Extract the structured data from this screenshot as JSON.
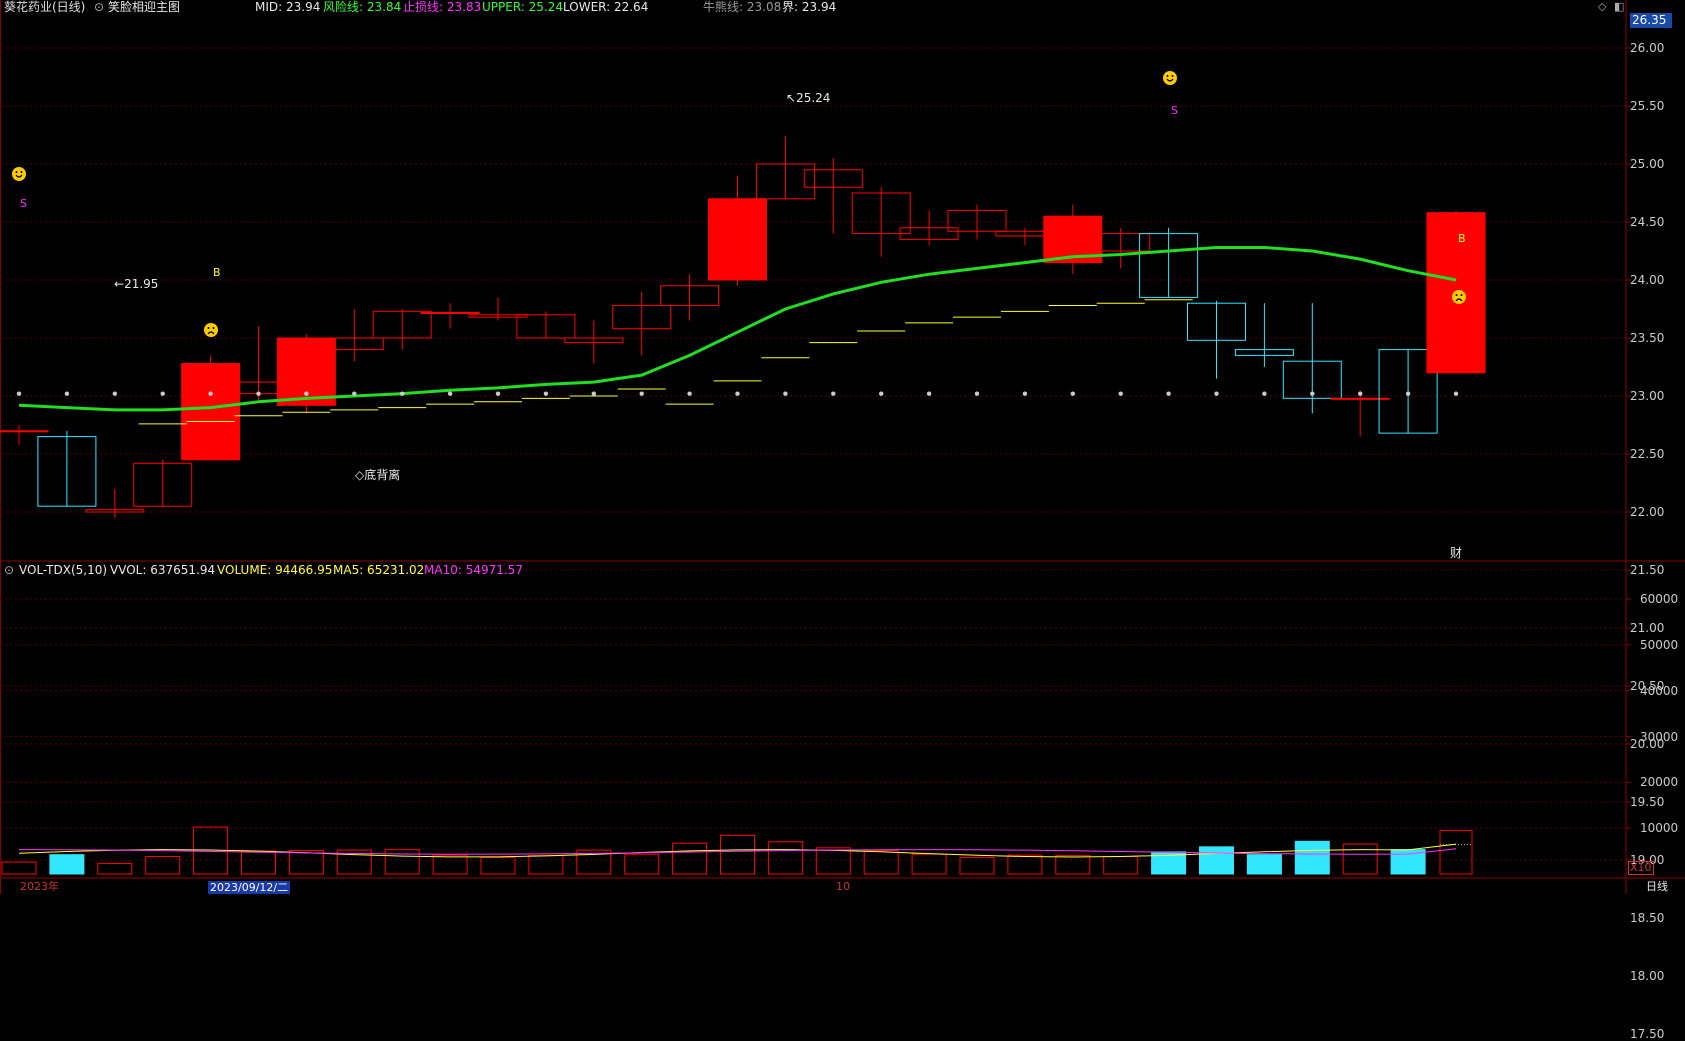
{
  "header": {
    "stock_title": "葵花药业(日线)",
    "formula_name": "笑脸相迎主图",
    "mid_label": "MID: 23.94",
    "risk_label": "风险线: 23.84",
    "stop_label": "止损线: 23.83",
    "upper_label": "UPPER: 25.24",
    "lower_label": "LOWER: 22.64",
    "bull_bear_label": "牛熊线: 23.08",
    "boundary_label": "界: 23.94"
  },
  "volume_header": {
    "indicator": "VOL-TDX(5,10)",
    "vvol": "VVOL: 637651.94",
    "volume": "VOLUME: 94466.95",
    "ma5": "MA5: 65231.02",
    "ma10": "MA10: 54971.57"
  },
  "price_axis": {
    "current_price": "26.35",
    "ticks": [
      "26.00",
      "25.50",
      "25.00",
      "24.50",
      "24.00",
      "23.50",
      "23.00",
      "22.50",
      "22.00",
      "21.50",
      "21.00",
      "20.50",
      "20.00",
      "19.50",
      "19.00",
      "18.50",
      "18.00",
      "17.50"
    ]
  },
  "volume_axis": {
    "ticks": [
      "60000",
      "50000",
      "40000",
      "30000",
      "20000",
      "10000"
    ],
    "multiplier": "X10"
  },
  "annotations": {
    "high_label": "25.24",
    "low_label": "21.95",
    "divergence_label": "底背离",
    "finance_marker": "财",
    "signal_s": "S",
    "signal_b": "B"
  },
  "bottom_bar": {
    "year_label": "2023年",
    "selected_date": "2023/09/12/二",
    "month_label": "10",
    "period_label": "日线"
  },
  "colors": {
    "up": "#ff0000",
    "down": "#33e6ff",
    "mid_line": "#22dd22",
    "risk_line": "#ffff33",
    "ma10": "#ff33ff",
    "grid": "#5a0000",
    "background": "#000000"
  },
  "chart_data": {
    "type": "candlestick",
    "candles": [
      {
        "open": 22.7,
        "close": 22.7,
        "high": 22.75,
        "low": 22.58,
        "volume": 2600
      },
      {
        "open": 22.65,
        "close": 22.05,
        "high": 22.7,
        "low": 22.05,
        "volume": 4200
      },
      {
        "open": 22.0,
        "close": 22.02,
        "high": 22.2,
        "low": 21.95,
        "volume": 2300
      },
      {
        "open": 22.05,
        "close": 22.42,
        "high": 22.45,
        "low": 22.05,
        "volume": 3800
      },
      {
        "open": 22.45,
        "close": 23.28,
        "high": 23.35,
        "low": 22.45,
        "volume": 10200
      },
      {
        "open": 23.02,
        "close": 23.12,
        "high": 23.6,
        "low": 22.95,
        "volume": 5000
      },
      {
        "open": 22.92,
        "close": 23.5,
        "high": 23.53,
        "low": 22.85,
        "volume": 5100
      },
      {
        "open": 23.4,
        "close": 23.5,
        "high": 23.75,
        "low": 23.3,
        "volume": 5200
      },
      {
        "open": 23.5,
        "close": 23.73,
        "high": 23.75,
        "low": 23.4,
        "volume": 5300
      },
      {
        "open": 23.72,
        "close": 23.72,
        "high": 23.8,
        "low": 23.58,
        "volume": 4100
      },
      {
        "open": 23.68,
        "close": 23.7,
        "high": 23.85,
        "low": 23.65,
        "volume": 3600
      },
      {
        "open": 23.5,
        "close": 23.7,
        "high": 23.73,
        "low": 23.5,
        "volume": 4000
      },
      {
        "open": 23.46,
        "close": 23.5,
        "high": 23.65,
        "low": 23.28,
        "volume": 5200
      },
      {
        "open": 23.58,
        "close": 23.78,
        "high": 23.9,
        "low": 23.35,
        "volume": 4300
      },
      {
        "open": 23.78,
        "close": 23.95,
        "high": 24.05,
        "low": 23.65,
        "volume": 6700
      },
      {
        "open": 24.0,
        "close": 24.7,
        "high": 24.9,
        "low": 23.95,
        "volume": 8400
      },
      {
        "open": 24.7,
        "close": 25.0,
        "high": 25.24,
        "low": 24.7,
        "volume": 7000
      },
      {
        "open": 24.8,
        "close": 24.95,
        "high": 25.05,
        "low": 24.4,
        "volume": 5700
      },
      {
        "open": 24.4,
        "close": 24.75,
        "high": 24.8,
        "low": 24.2,
        "volume": 5100
      },
      {
        "open": 24.35,
        "close": 24.45,
        "high": 24.6,
        "low": 24.3,
        "volume": 4300
      },
      {
        "open": 24.42,
        "close": 24.6,
        "high": 24.65,
        "low": 24.35,
        "volume": 3600
      },
      {
        "open": 24.38,
        "close": 24.42,
        "high": 24.45,
        "low": 24.3,
        "volume": 4100
      },
      {
        "open": 24.15,
        "close": 24.55,
        "high": 24.65,
        "low": 24.05,
        "volume": 4000
      },
      {
        "open": 24.25,
        "close": 24.4,
        "high": 24.45,
        "low": 24.1,
        "volume": 3800
      },
      {
        "open": 24.4,
        "close": 23.85,
        "high": 24.45,
        "low": 23.85,
        "volume": 4800
      },
      {
        "open": 23.8,
        "close": 23.48,
        "high": 23.82,
        "low": 23.15,
        "volume": 5900
      },
      {
        "open": 23.4,
        "close": 23.35,
        "high": 23.8,
        "low": 23.25,
        "volume": 4200
      },
      {
        "open": 23.3,
        "close": 22.98,
        "high": 23.8,
        "low": 22.85,
        "volume": 7100
      },
      {
        "open": 22.98,
        "close": 22.98,
        "high": 23.05,
        "low": 22.65,
        "volume": 6500
      },
      {
        "open": 23.4,
        "close": 22.68,
        "high": 23.4,
        "low": 22.68,
        "volume": 5300
      },
      {
        "open": 23.2,
        "close": 24.58,
        "high": 24.6,
        "low": 23.2,
        "volume": 94466.95
      }
    ],
    "mid_line_ma": "MID",
    "ylim": [
      17.5,
      26.35
    ],
    "volume_ylim": [
      0,
      65000
    ]
  }
}
